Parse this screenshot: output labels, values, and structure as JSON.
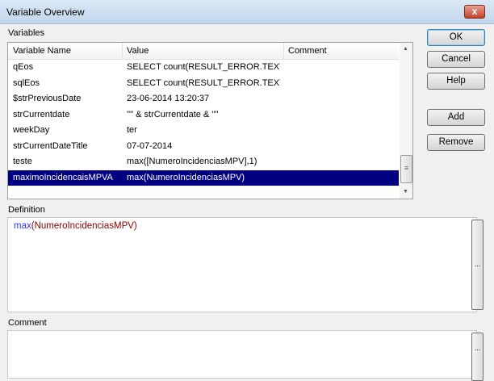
{
  "window": {
    "title": "Variable Overview",
    "close_label": "x"
  },
  "variables": {
    "label": "Variables",
    "columns": [
      "Variable Name",
      "Value",
      "Comment"
    ],
    "rows": [
      {
        "name": "qEos",
        "value": "SELECT count(RESULT_ERROR.TEXT",
        "comment": ""
      },
      {
        "name": "sqlEos",
        "value": "SELECT count(RESULT_ERROR.TEXT",
        "comment": ""
      },
      {
        "name": "$strPreviousDate",
        "value": "23-06-2014 13:20:37",
        "comment": ""
      },
      {
        "name": "strCurrentdate",
        "value": "'\"' & strCurrentdate & '\"'",
        "comment": ""
      },
      {
        "name": "weekDay",
        "value": "ter",
        "comment": ""
      },
      {
        "name": "strCurrentDateTitle",
        "value": "07-07-2014",
        "comment": ""
      },
      {
        "name": "teste",
        "value": "max([NumeroIncidenciasMPV],1)",
        "comment": ""
      },
      {
        "name": "maximoIncidencaisMPVA",
        "value": "max(NumeroIncidenciasMPV)",
        "comment": ""
      }
    ],
    "selected_index": 7
  },
  "buttons": {
    "ok": "OK",
    "cancel": "Cancel",
    "help": "Help",
    "add": "Add",
    "remove": "Remove"
  },
  "definition": {
    "label": "Definition",
    "func": "max",
    "args": "(NumeroIncidenciasMPV)",
    "ellipsis": "..."
  },
  "comment": {
    "label": "Comment",
    "value": "",
    "ellipsis": "..."
  }
}
